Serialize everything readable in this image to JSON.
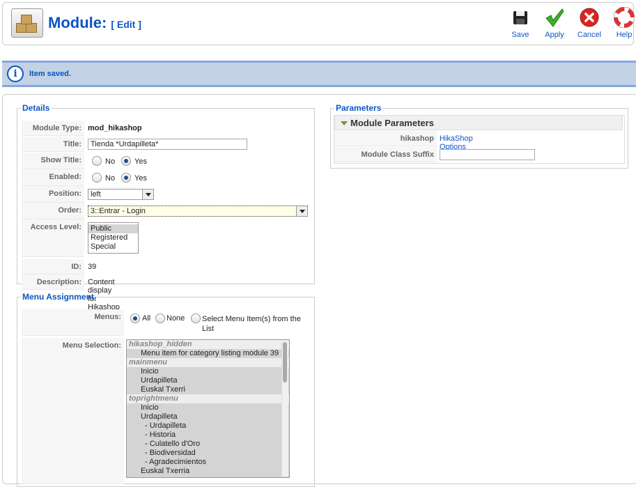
{
  "header": {
    "title": "Module:",
    "subtitle": "[ Edit ]"
  },
  "toolbar": {
    "buttons": [
      {
        "label": "Save",
        "icon": "floppy-disk-icon"
      },
      {
        "label": "Apply",
        "icon": "checkmark-icon"
      },
      {
        "label": "Cancel",
        "icon": "cancel-icon"
      },
      {
        "label": "Help",
        "icon": "lifebuoy-icon"
      }
    ]
  },
  "message": {
    "text": "Item saved.",
    "icon": "info-icon"
  },
  "details": {
    "legend": "Details",
    "module_type": {
      "label": "Module Type:",
      "value": "mod_hikashop"
    },
    "title": {
      "label": "Title:",
      "value": "Tienda *Urdapilleta*"
    },
    "show_title": {
      "label": "Show Title:",
      "no": "No",
      "yes": "Yes",
      "selected": "Yes"
    },
    "enabled": {
      "label": "Enabled:",
      "no": "No",
      "yes": "Yes",
      "selected": "Yes"
    },
    "position": {
      "label": "Position:",
      "value": "left"
    },
    "order": {
      "label": "Order:",
      "value": "3::Entrar - Login"
    },
    "access_level": {
      "label": "Access Level:",
      "options": [
        "Public",
        "Registered",
        "Special"
      ],
      "selected": "Public"
    },
    "id": {
      "label": "ID:",
      "value": "39"
    },
    "description": {
      "label": "Description:",
      "value": "Content display for Hikashop"
    }
  },
  "menu_assignment": {
    "legend": "Menu Assignment",
    "menus": {
      "label": "Menus:",
      "all": "All",
      "none": "None",
      "select": "Select Menu Item(s) from the List",
      "selected": "All"
    },
    "menu_selection": {
      "label": "Menu Selection:",
      "groups": [
        {
          "name": "hikashop_hidden",
          "items": [
            "Menu item for category listing module 39"
          ]
        },
        {
          "name": "mainmenu",
          "items": [
            "Inicio",
            "Urdapilleta",
            "Euskal Txerri"
          ]
        },
        {
          "name": "toprightmenu",
          "items": [
            "Inicio",
            "Urdapilleta",
            "- Urdapilleta",
            "- Historia",
            "- Culatello d'Oro",
            "- Biodiversidad",
            "- Agradecimientos",
            "Euskal Txerria"
          ]
        }
      ]
    }
  },
  "parameters": {
    "legend": "Parameters",
    "panel_title": "Module Parameters",
    "hikashop": {
      "label": "hikashop",
      "link": "HikaShop Options"
    },
    "suffix": {
      "label": "Module Class Suffix",
      "value": ""
    }
  }
}
